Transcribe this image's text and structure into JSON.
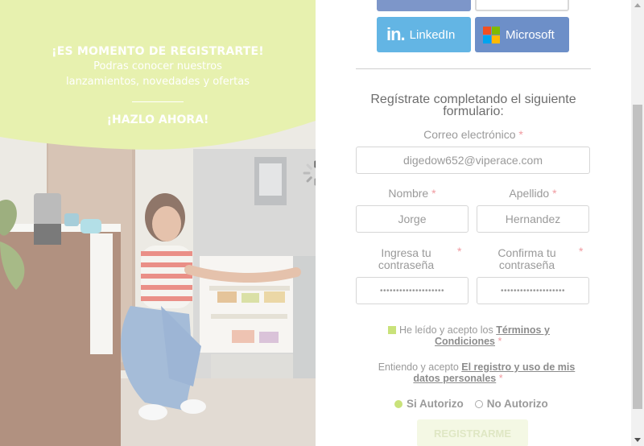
{
  "promo": {
    "title": "¡ES MOMENTO DE REGISTRARTE!",
    "subtitle_line1": "Podras conocer nuestros",
    "subtitle_line2": "lanzamientos, novedades y ofertas",
    "cta": "¡HAZLO AHORA!",
    "accent_color": "#dcea8a"
  },
  "social": {
    "linkedin_label": "LinkedIn",
    "microsoft_label": "Microsoft",
    "facebook_icon": "facebook-icon",
    "google_icon": "google-icon"
  },
  "form": {
    "heading_line1": "Regístrate completando el siguiente",
    "heading_line2": "formulario:",
    "email_label": "Correo electrónico",
    "email_value": "digedow652@viperace.com",
    "nombre_label": "Nombre",
    "nombre_value": "Jorge",
    "apellido_label": "Apellido",
    "apellido_value": "Hernandez",
    "password_label_line1": "Ingresa tu",
    "password_label_line2": "contraseña",
    "confirm_label_line1": "Confirma tu",
    "confirm_label_line2": "contraseña",
    "password_value": "••••••••••••••••••••",
    "confirm_value": "••••••••••••••••••••",
    "required_mark": "*",
    "terms_prefix": "He leído y acepto los",
    "terms_link_line1": "Términos y",
    "terms_link_line2": "Condiciones",
    "consent_prefix": "Entiendo y acepto",
    "consent_link_line1": "El registro y uso de mis",
    "consent_link_line2": "datos personales",
    "radio_yes": "Si Autorizo",
    "radio_no": "No Autorizo",
    "submit_label": "REGISTRARME"
  }
}
